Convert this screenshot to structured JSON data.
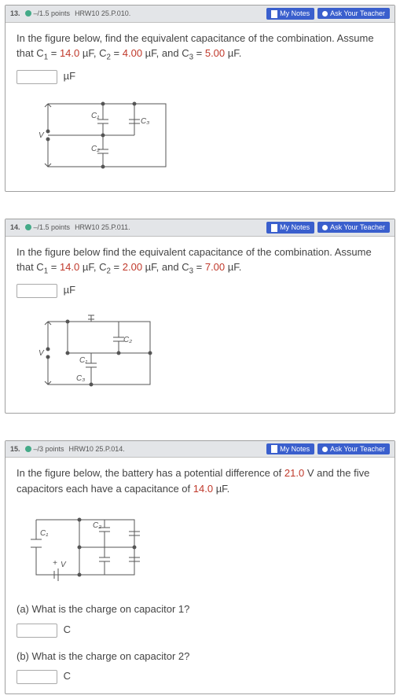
{
  "problems": [
    {
      "number": "13.",
      "points": "–/1.5 points",
      "ref": "HRW10 25.P.010.",
      "notes_label": "My Notes",
      "ask_label": "Ask Your Teacher",
      "prompt_before": "In the figure below, find the equivalent capacitance of the combination. Assume that C",
      "c1_sub": "1",
      "c1_eq": " = ",
      "c1_val": "14.0",
      "c1_unit": " µF, C",
      "c2_sub": "2",
      "c2_eq": " = ",
      "c2_val": "4.00",
      "c2_unit": " µF, and C",
      "c3_sub": "3",
      "c3_eq": " = ",
      "c3_val": "5.00",
      "c3_unit": " µF.",
      "answer_unit": "µF"
    },
    {
      "number": "14.",
      "points": "–/1.5 points",
      "ref": "HRW10 25.P.011.",
      "notes_label": "My Notes",
      "ask_label": "Ask Your Teacher",
      "prompt_before": "In the figure below find the equivalent capacitance of the combination. Assume that C",
      "c1_sub": "1",
      "c1_eq": " = ",
      "c1_val": "14.0",
      "c1_unit": " µF, C",
      "c2_sub": "2",
      "c2_eq": " = ",
      "c2_val": "2.00",
      "c2_unit": " µF, and C",
      "c3_sub": "3",
      "c3_eq": " = ",
      "c3_val": "7.00",
      "c3_unit": " µF.",
      "answer_unit": "µF"
    },
    {
      "number": "15.",
      "points": "–/3 points",
      "ref": "HRW10 25.P.014.",
      "notes_label": "My Notes",
      "ask_label": "Ask Your Teacher",
      "prompt_a": "In the figure below, the battery has a potential difference of ",
      "v_val": "21.0",
      "v_unit": " V and the five capacitors each have a capacitance of ",
      "c_val": "14.0",
      "c_unit": " µF.",
      "part_a_label": "(a) What is the charge on capacitor 1?",
      "part_a_unit": "C",
      "part_b_label": "(b) What is the charge on capacitor 2?",
      "part_b_unit": "C"
    }
  ]
}
